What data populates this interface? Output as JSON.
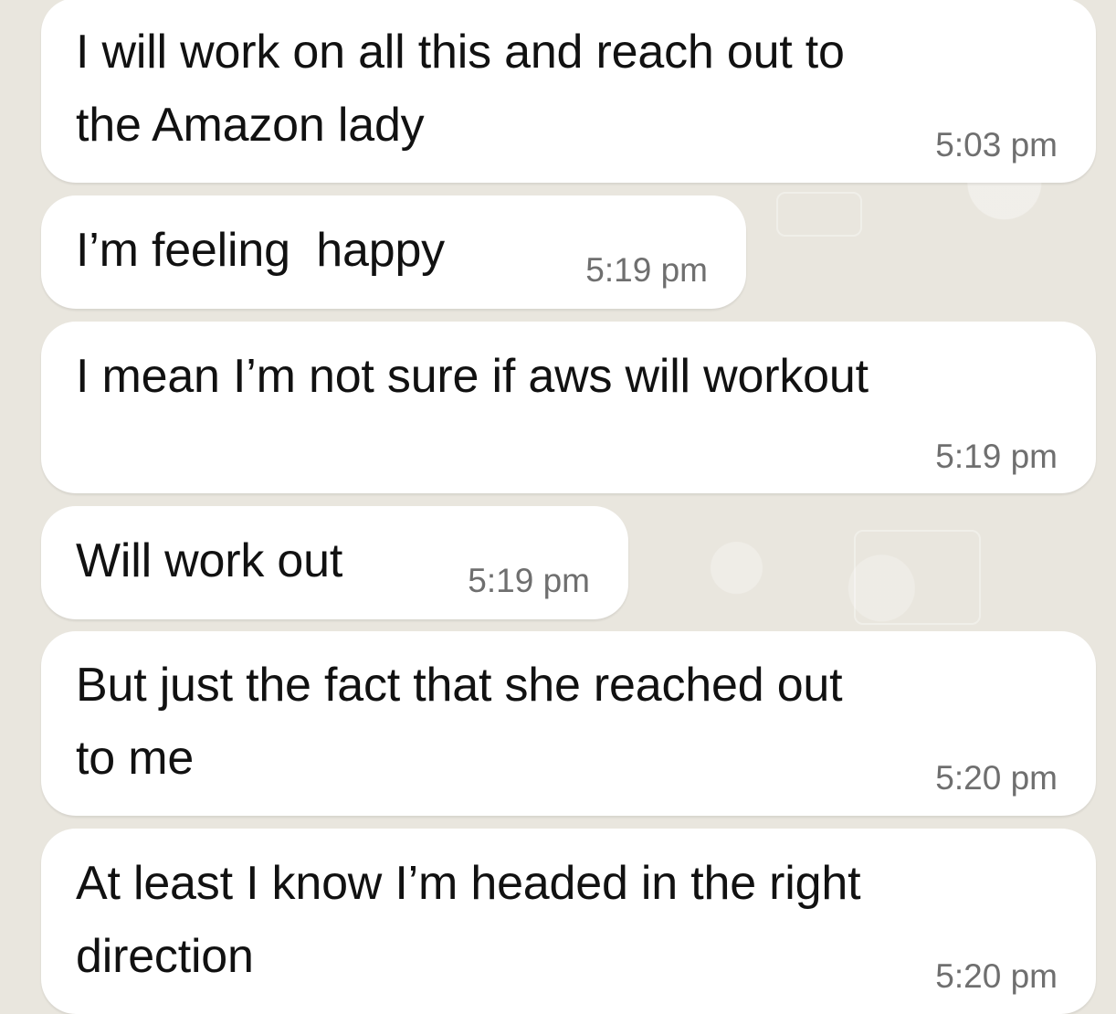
{
  "messages": [
    {
      "lines": [
        "I will work on all this and reach out to",
        "the Amazon lady"
      ],
      "time": "5:03 pm"
    },
    {
      "lines": [
        "I’m feeling  happy"
      ],
      "time": "5:19 pm"
    },
    {
      "lines": [
        "I mean I’m not sure if aws will workout"
      ],
      "time": "5:19 pm"
    },
    {
      "lines": [
        "Will work out"
      ],
      "time": "5:19 pm"
    },
    {
      "lines": [
        "But just the fact that she reached out",
        "to me"
      ],
      "time": "5:20 pm"
    },
    {
      "lines": [
        "At least I know I’m headed in the right",
        "direction"
      ],
      "time": "5:20 pm"
    }
  ]
}
